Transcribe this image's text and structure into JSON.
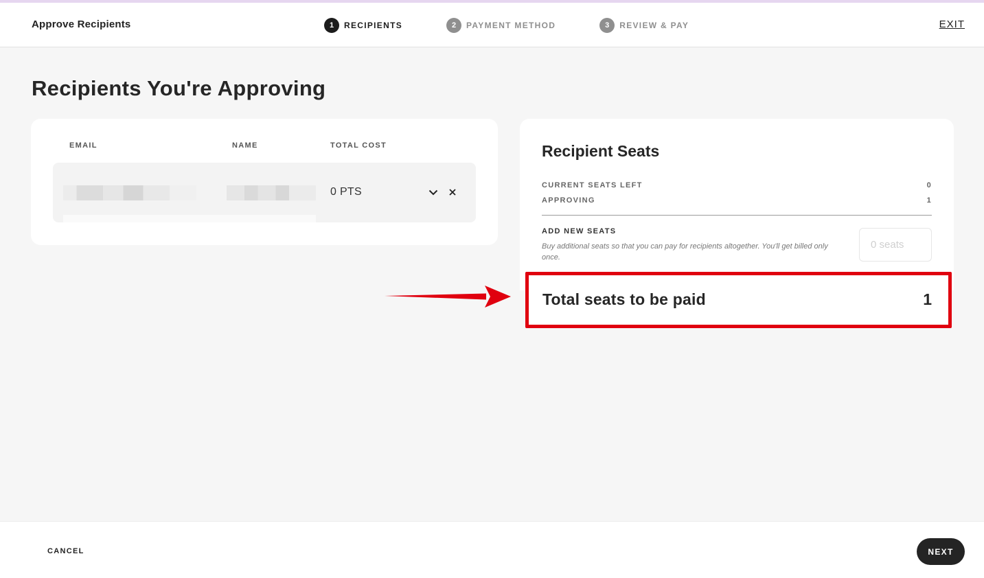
{
  "header": {
    "title": "Approve Recipients",
    "steps": [
      {
        "number": "1",
        "label": "RECIPIENTS",
        "state": "active"
      },
      {
        "number": "2",
        "label": "PAYMENT METHOD",
        "state": "inactive"
      },
      {
        "number": "3",
        "label": "REVIEW & PAY",
        "state": "inactive"
      }
    ],
    "exit_label": "EXIT"
  },
  "page_title": "Recipients You're Approving",
  "recipients_table": {
    "columns": [
      "EMAIL",
      "NAME",
      "TOTAL COST"
    ],
    "rows": [
      {
        "email": "",
        "name": "",
        "total_cost": "0 PTS",
        "icons": [
          "chevron-down-icon",
          "close-icon"
        ]
      }
    ]
  },
  "seats": {
    "title": "Recipient Seats",
    "current_seats_left_label": "CURRENT SEATS LEFT",
    "current_seats_left_value": "0",
    "approving_label": "APPROVING",
    "approving_value": "1",
    "add_new_seats_label": "ADD NEW SEATS",
    "add_new_seats_description": "Buy additional seats so that you can pay for recipients altogether. You'll get billed only once.",
    "seats_input_placeholder": "0 seats",
    "total_label": "Total seats to be paid",
    "total_value": "1"
  },
  "footer": {
    "cancel_label": "CANCEL",
    "next_label": "NEXT"
  },
  "colors": {
    "highlight": "#e0000f",
    "dark_button": "#242424",
    "active_step": "#1c1c1c",
    "inactive_step": "#8f8f8f"
  }
}
